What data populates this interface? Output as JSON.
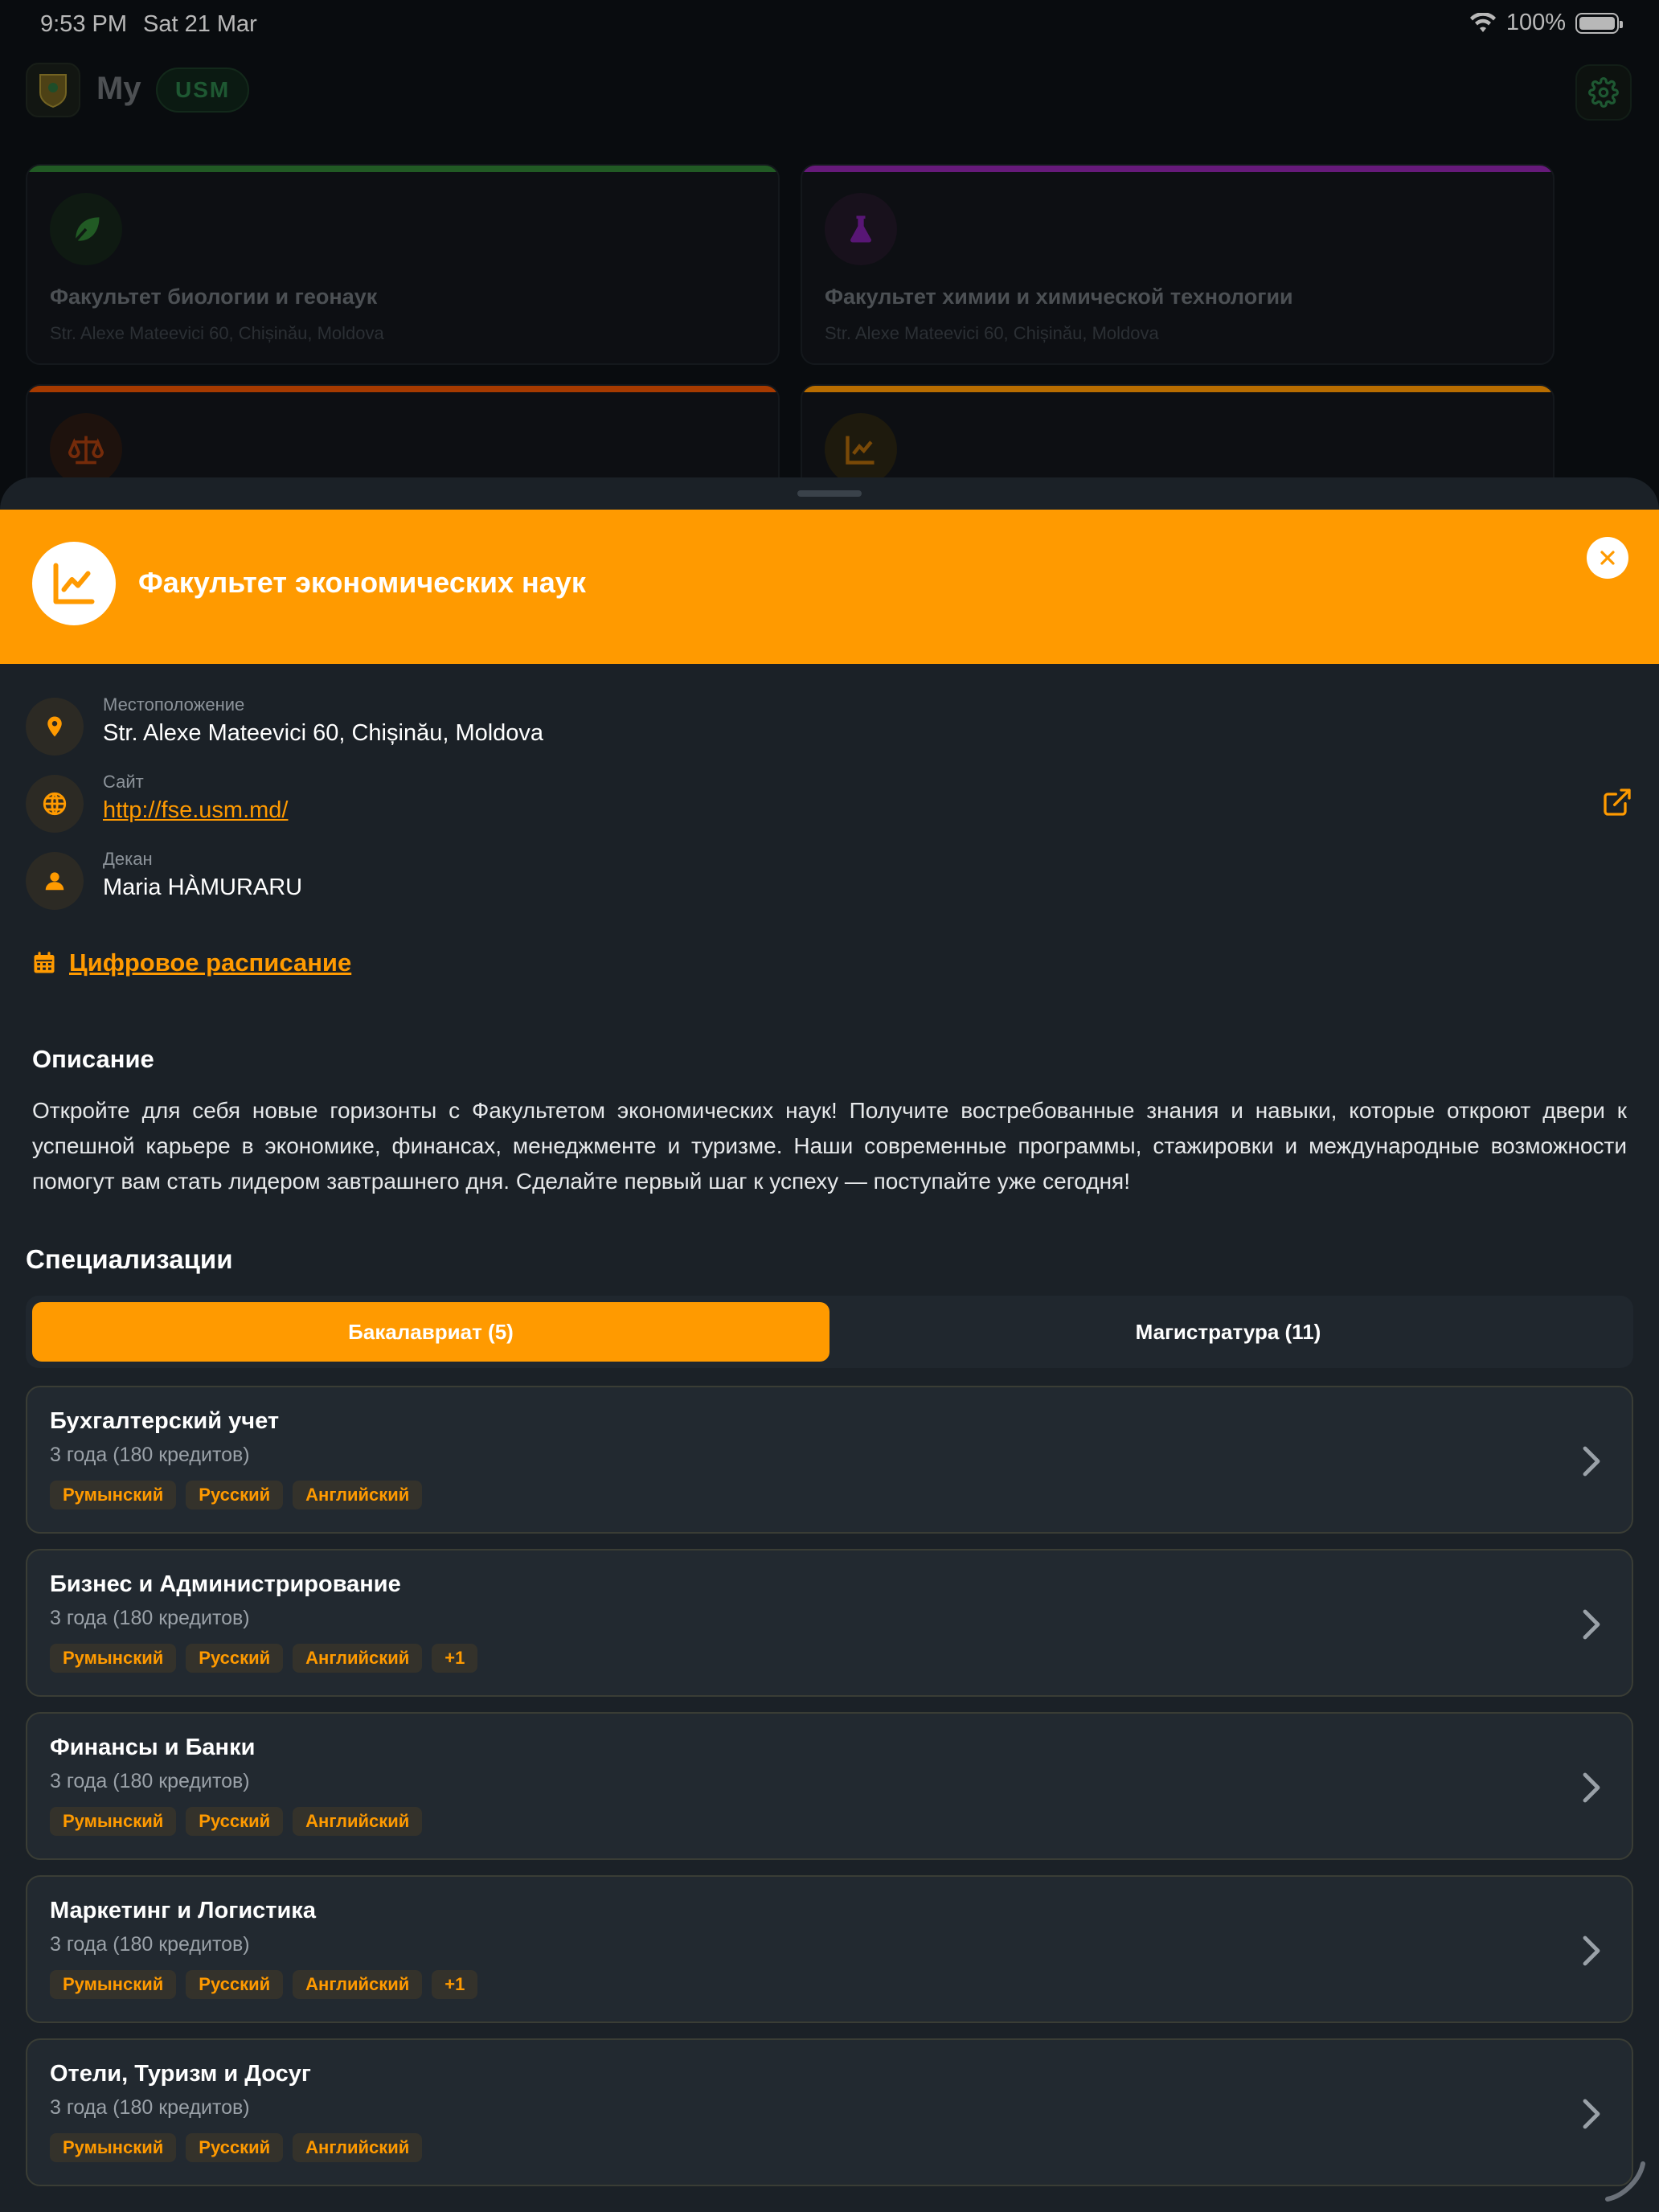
{
  "status_bar": {
    "time": "9:53 PM",
    "date": "Sat 21 Mar",
    "battery": "100%"
  },
  "app": {
    "title_prefix": "My",
    "badge": "USM"
  },
  "background_cards": [
    {
      "name": "Факультет биологии и геонаук",
      "address": "Str. Alexe Mateevici 60, Chișinău, Moldova",
      "accent": "#2e7d32",
      "icon": "leaf-icon"
    },
    {
      "name": "Факультет химии и химической технологии",
      "address": "Str. Alexe Mateevici 60, Chișinău, Moldova",
      "accent": "#8e24aa",
      "icon": "flask-icon"
    },
    {
      "name": "",
      "address": "",
      "accent": "#e65100",
      "icon": "scales-icon"
    },
    {
      "name": "",
      "address": "",
      "accent": "#ff9800",
      "icon": "chart-icon"
    }
  ],
  "sheet": {
    "accent": "#ff9a00",
    "title": "Факультет экономических наук",
    "location": {
      "label": "Местоположение",
      "value": "Str. Alexe Mateevici 60, Chișinău, Moldova"
    },
    "site": {
      "label": "Сайт",
      "value": "http://fse.usm.md/"
    },
    "dean": {
      "label": "Декан",
      "value": "Maria HÀMURARU"
    },
    "schedule_link": "Цифровое расписание",
    "description_title": "Описание",
    "description": "Откройте для себя новые горизонты с Факультетом экономических наук! Получите востребованные знания и навыки, которые откроют двери к успешной карьере в экономике, финансах, менеджменте и туризме. Наши современные программы, стажировки и международные возможности помогут вам стать лидером завтрашнего дня. Сделайте первый шаг к успеху — поступайте уже сегодня!",
    "specializations_title": "Специализации",
    "tabs": [
      {
        "label": "Бакалавриат (5)",
        "active": true
      },
      {
        "label": "Магистратура (11)",
        "active": false
      }
    ],
    "programs": [
      {
        "name": "Бухгалтерский учет",
        "meta": "3 года (180 кредитов)",
        "tags": [
          "Румынский",
          "Русский",
          "Английский"
        ]
      },
      {
        "name": "Бизнес и Администрирование",
        "meta": "3 года (180 кредитов)",
        "tags": [
          "Румынский",
          "Русский",
          "Английский",
          "+1"
        ]
      },
      {
        "name": "Финансы и Банки",
        "meta": "3 года (180 кредитов)",
        "tags": [
          "Румынский",
          "Русский",
          "Английский"
        ]
      },
      {
        "name": "Маркетинг и Логистика",
        "meta": "3 года (180 кредитов)",
        "tags": [
          "Румынский",
          "Русский",
          "Английский",
          "+1"
        ]
      },
      {
        "name": "Отели, Туризм и Досуг",
        "meta": "3 года (180 кредитов)",
        "tags": [
          "Румынский",
          "Русский",
          "Английский"
        ]
      }
    ]
  }
}
